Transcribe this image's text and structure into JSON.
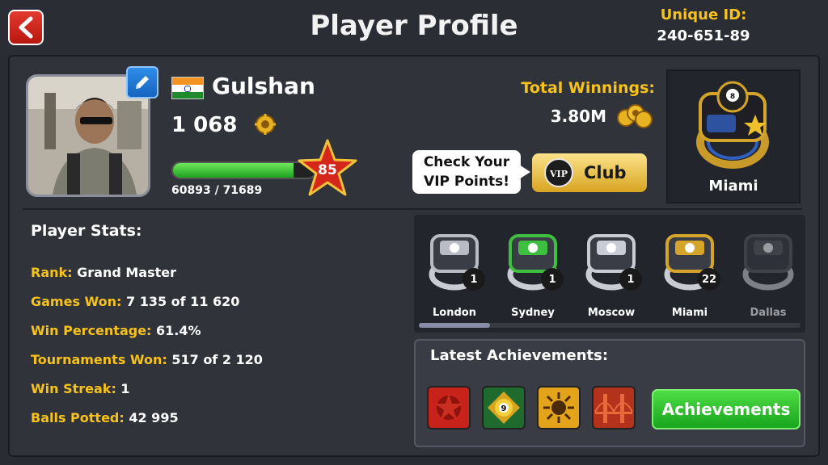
{
  "header": {
    "title": "Player Profile",
    "unique_id_label": "Unique ID:",
    "unique_id_value": "240-651-89"
  },
  "player": {
    "name": "Gulshan",
    "coins": "1 068",
    "xp_text": "60893 / 71689",
    "xp_fraction": 0.849,
    "level": "85",
    "flag": "india"
  },
  "winnings": {
    "label": "Total Winnings:",
    "value": "3.80M"
  },
  "vip": {
    "bubble_line1": "Check Your",
    "bubble_line2": "VIP Points!",
    "club_label": "Club",
    "badge": "VIP"
  },
  "featured_ring": {
    "name": "Miami"
  },
  "stats": {
    "title": "Player Stats:",
    "rows": [
      {
        "key": "Rank:",
        "value": "Grand Master"
      },
      {
        "key": "Games Won:",
        "value": "7 135 of 11 620"
      },
      {
        "key": "Win Percentage:",
        "value": "61.4%"
      },
      {
        "key": "Tournaments Won:",
        "value": "517 of 2 120"
      },
      {
        "key": "Win Streak:",
        "value": "1"
      },
      {
        "key": "Balls Potted:",
        "value": "42 995"
      }
    ]
  },
  "rings": [
    {
      "name": "London",
      "count": "1",
      "color": "#b9bcc4"
    },
    {
      "name": "Sydney",
      "count": "1",
      "color": "#3fbf3f"
    },
    {
      "name": "Moscow",
      "count": "1",
      "color": "#c9ccd4"
    },
    {
      "name": "Miami",
      "count": "22",
      "color": "#d4a52a"
    },
    {
      "name": "Dallas",
      "count": "",
      "color": "#5a5c64"
    }
  ],
  "achievements": {
    "title": "Latest Achievements:",
    "button_label": "Achievements",
    "icons": [
      {
        "name": "red-emblem-icon",
        "bg": "#c8231b"
      },
      {
        "name": "nine-ball-icon",
        "bg": "#1f6b2d",
        "label": "9"
      },
      {
        "name": "sun-emblem-icon",
        "bg": "#e3a31a"
      },
      {
        "name": "golden-gate-icon",
        "bg": "#b2321c"
      }
    ]
  }
}
